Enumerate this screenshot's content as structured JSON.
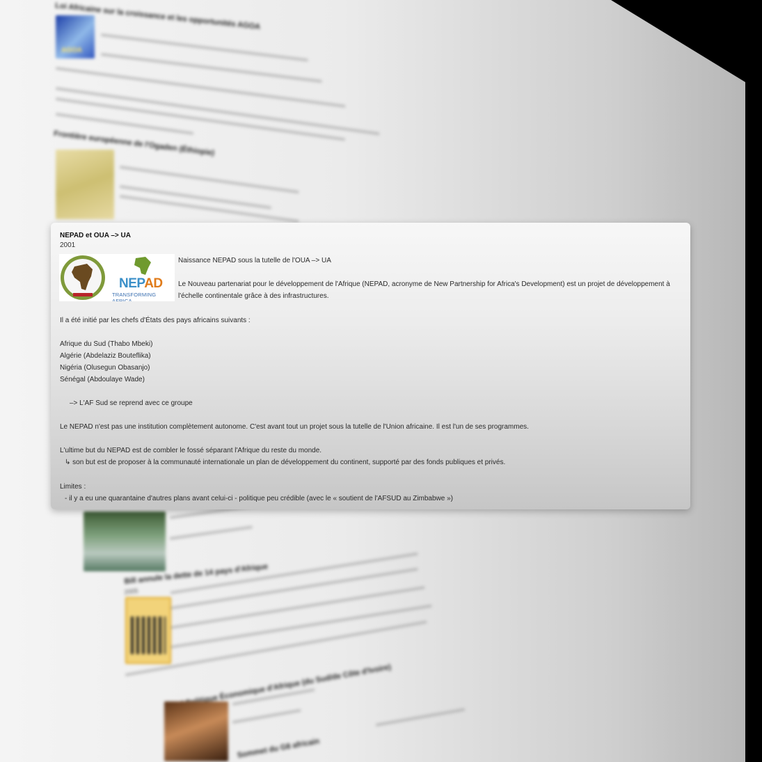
{
  "background_items": {
    "item1_title": "Loi Africaine sur la croissance et les opportunités AGOA",
    "item1_thumb_label": "AGOA",
    "item2_title": "Frontière européenne de l'Ogaden (Éthiopie)",
    "item3_title": "",
    "item4_title": "Bill annule la dette de 14 pays d'Afrique",
    "item4_year": "2005",
    "item5_title": "Mikal Politique Économique d'Afrique (du Sud/de Côte d'Ivoire)",
    "item6_title": "Sommet du G8 africain"
  },
  "card": {
    "title": "NEPAD et OUA –> UA",
    "year": "2001",
    "logo_text": "NEPAD",
    "logo_subtext": "TRANSFORMING AFRICA",
    "line1": "Naissance NEPAD sous la tutelle de l'OUA –> UA",
    "line2": "Le Nouveau partenariat pour le développement de l'Afrique (NEPAD, acronyme de New Partnership for Africa's Development) est un projet de développement à",
    "line3": "l'échelle continentale grâce à des infrastructures.",
    "line4": "Il a été initié par les chefs d'États des pays africains suivants :",
    "list": [
      "Afrique du Sud (Thabo Mbeki)",
      "Algérie (Abdelaziz Bouteflika)",
      "Nigéria (Olusegun Obasanjo)",
      "Sénégal (Abdoulaye Wade)"
    ],
    "line5": "–> L'AF Sud se reprend avec ce groupe",
    "line6": "Le NEPAD n'est pas une institution complètement autonome. C'est avant tout un projet sous la tutelle de l'Union africaine. Il est l'un de ses programmes.",
    "line7": "L'ultime but du NEPAD est de combler le fossé séparant l'Afrique du reste du monde.",
    "line8": "↳ son but est de proposer à la communauté internationale un plan de développement du continent, supporté par des fonds publiques et privés.",
    "line9": "Limites :",
    "line10": "- il y a eu une quarantaine d'autres plans avant celui-ci - politique peu crédible (avec le « soutient de l'AFSUD au Zimbabwe »)"
  }
}
